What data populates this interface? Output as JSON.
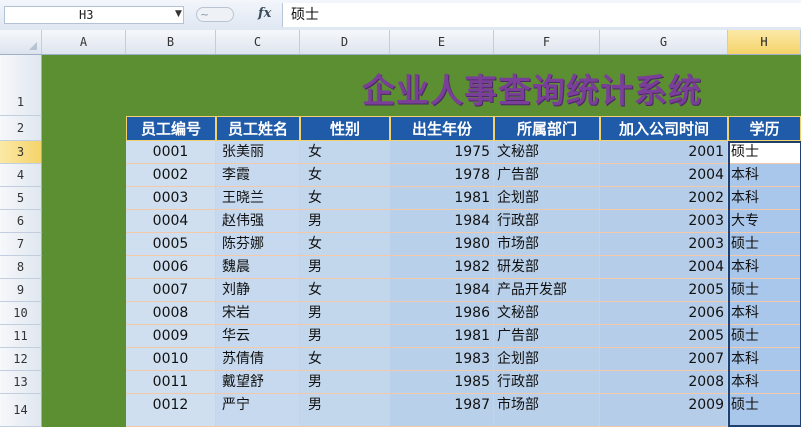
{
  "formula_bar": {
    "name_box": "H3",
    "formula_value": "硕士",
    "fx_label": "fx",
    "circle_label": "~"
  },
  "columns": [
    "A",
    "B",
    "C",
    "D",
    "E",
    "F",
    "G",
    "H"
  ],
  "active_column": "H",
  "rows": [
    "1",
    "2",
    "3",
    "4",
    "5",
    "6",
    "7",
    "8",
    "9",
    "10",
    "11",
    "12",
    "13",
    "14"
  ],
  "active_row": "3",
  "sheet": {
    "title": "企业人事查询统计系统",
    "headers": [
      "员工编号",
      "员工姓名",
      "性别",
      "出生年份",
      "所属部门",
      "加入公司时间",
      "学历"
    ],
    "records": [
      [
        "0001",
        "张美丽",
        "女",
        "1975",
        "文秘部",
        "2001",
        "硕士"
      ],
      [
        "0002",
        "李霞",
        "女",
        "1978",
        "广告部",
        "2004",
        "本科"
      ],
      [
        "0003",
        "王晓兰",
        "女",
        "1981",
        "企划部",
        "2002",
        "本科"
      ],
      [
        "0004",
        "赵伟强",
        "男",
        "1984",
        "行政部",
        "2003",
        "大专"
      ],
      [
        "0005",
        "陈芬娜",
        "女",
        "1980",
        "市场部",
        "2003",
        "硕士"
      ],
      [
        "0006",
        "魏晨",
        "男",
        "1982",
        "研发部",
        "2004",
        "本科"
      ],
      [
        "0007",
        "刘静",
        "女",
        "1984",
        "产品开发部",
        "2005",
        "硕士"
      ],
      [
        "0008",
        "宋岩",
        "男",
        "1986",
        "文秘部",
        "2006",
        "本科"
      ],
      [
        "0009",
        "华云",
        "男",
        "1981",
        "广告部",
        "2005",
        "硕士"
      ],
      [
        "0010",
        "苏倩倩",
        "女",
        "1983",
        "企划部",
        "2007",
        "本科"
      ],
      [
        "0011",
        "戴望舒",
        "男",
        "1985",
        "行政部",
        "2008",
        "本科"
      ],
      [
        "0012",
        "严宁",
        "男",
        "1987",
        "市场部",
        "2009",
        "硕士"
      ]
    ]
  },
  "colors": {
    "sheet_background": "#5c8e32",
    "title_color": "#7a3f98",
    "header_fill": "#1f5ba8",
    "header_border": "#f2d36b",
    "data_fill": "#b9d0ea"
  }
}
